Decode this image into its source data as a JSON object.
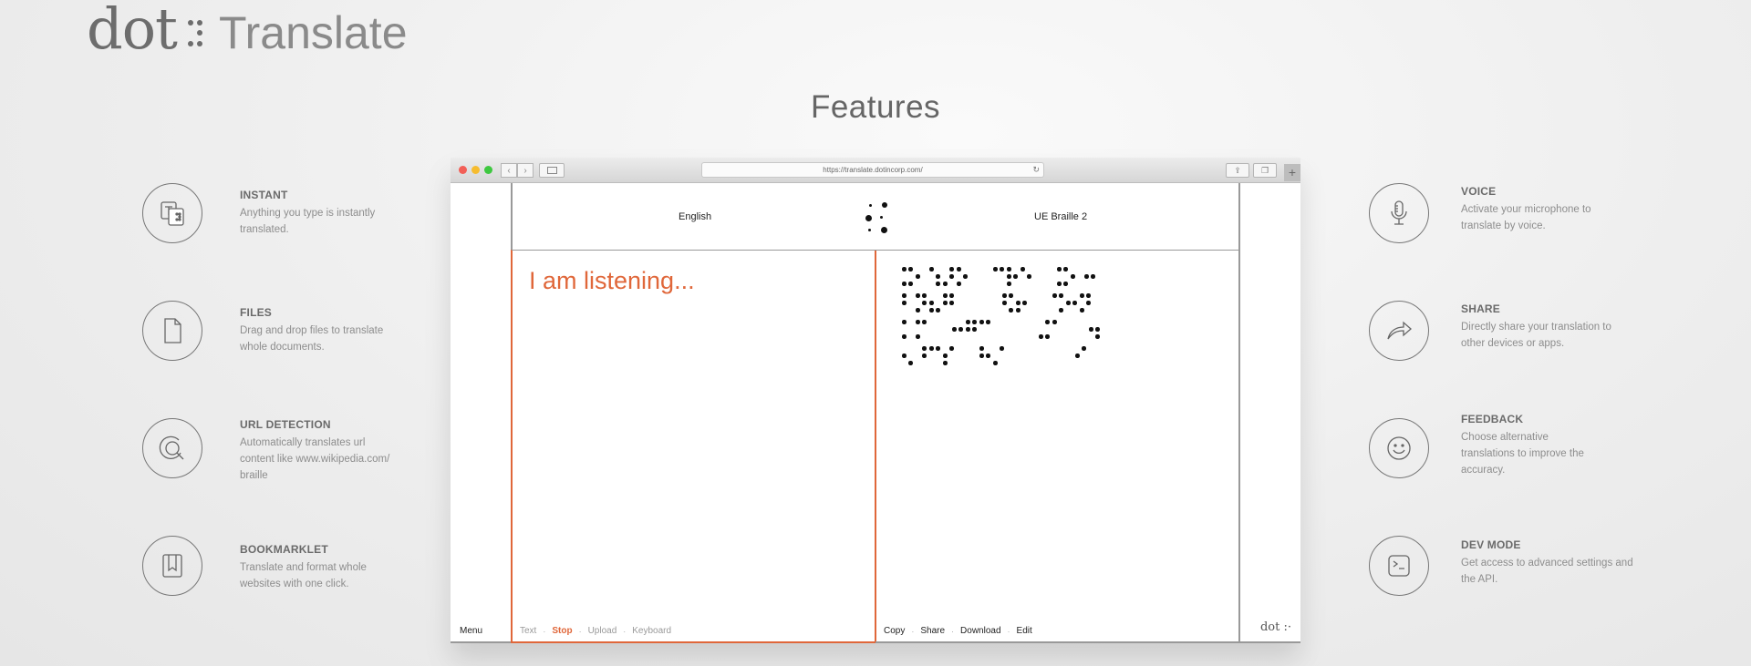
{
  "logo": {
    "word1": "dot",
    "word2": "Translate"
  },
  "title": "Features",
  "features_left": [
    {
      "icon": "translate-icon",
      "name": "INSTANT",
      "desc": "Anything you type is instantly translated."
    },
    {
      "icon": "file-icon",
      "name": "FILES",
      "desc": "Drag and drop files to translate whole documents."
    },
    {
      "icon": "url-search-icon",
      "name": "URL DETECTION",
      "desc": "Automatically translates url content like www.wikipedia.com/ braille"
    },
    {
      "icon": "bookmark-icon",
      "name": "BOOKMARKLET",
      "desc": "Translate and format whole websites with one click."
    }
  ],
  "features_right": [
    {
      "icon": "microphone-icon",
      "name": "VOICE",
      "desc": "Activate your microphone to translate by voice."
    },
    {
      "icon": "share-icon",
      "name": "SHARE",
      "desc": "Directly share your translation to other devices or apps."
    },
    {
      "icon": "smiley-icon",
      "name": "FEEDBACK",
      "desc": "Choose alternative translations to improve the accuracy."
    },
    {
      "icon": "terminal-icon",
      "name": "DEV MODE",
      "desc": "Get access to advanced settings and the API."
    }
  ],
  "browser": {
    "url": "https://translate.dotincorp.com/",
    "source_lang": "English",
    "target_lang": "UE Braille 2",
    "input_text": "I am listening...",
    "left_footer": {
      "menu": "Menu",
      "text": "Text",
      "stop": "Stop",
      "upload": "Upload",
      "keyboard": "Keyboard"
    },
    "right_footer": {
      "copy": "Copy",
      "share": "Share",
      "download": "Download",
      "edit": "Edit"
    },
    "mini_logo": "dot :·",
    "sep": "·"
  },
  "colors": {
    "accent": "#e0673a",
    "border": "#999999"
  }
}
